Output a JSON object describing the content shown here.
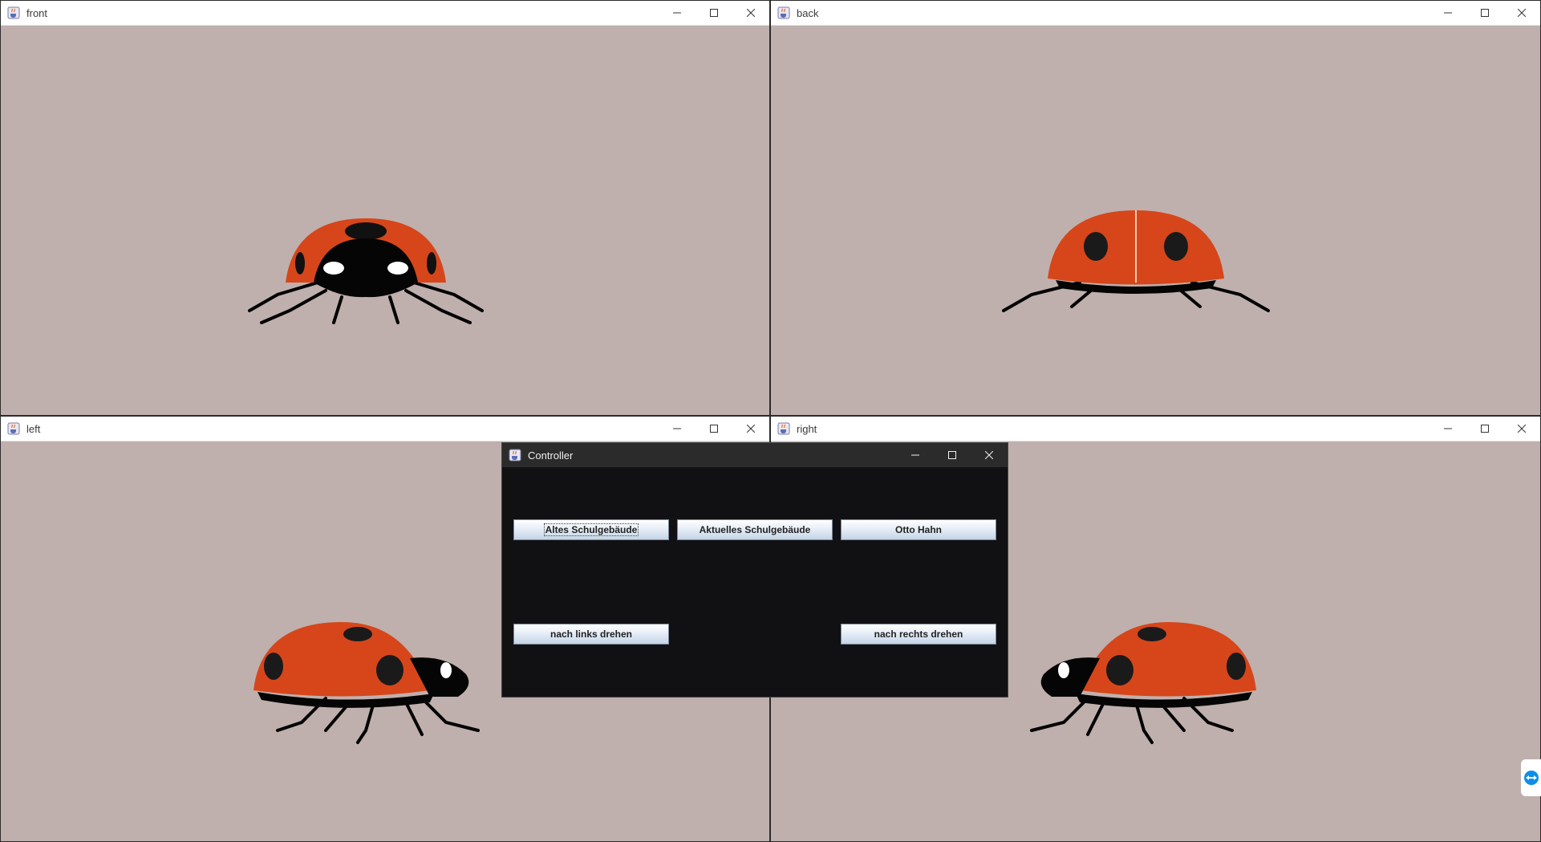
{
  "windows": {
    "front": {
      "title": "front"
    },
    "back": {
      "title": "back"
    },
    "left": {
      "title": "left"
    },
    "right": {
      "title": "right"
    }
  },
  "controller": {
    "title": "Controller",
    "buttons": {
      "altes": "Altes Schulgebäude",
      "aktuelles": "Aktuelles Schulgebäude",
      "otto": "Otto Hahn",
      "links": "nach links drehen",
      "rechts": "nach rechts drehen"
    }
  },
  "colors": {
    "viewport_bg": "#bfb0ad",
    "controller_bg": "#111114",
    "ladybug_red": "#d6461a"
  },
  "icons": {
    "window": "java-cup-icon",
    "minimize": "minimize-icon",
    "maximize": "maximize-icon",
    "close": "close-icon",
    "side_widget": "teamviewer-icon"
  }
}
